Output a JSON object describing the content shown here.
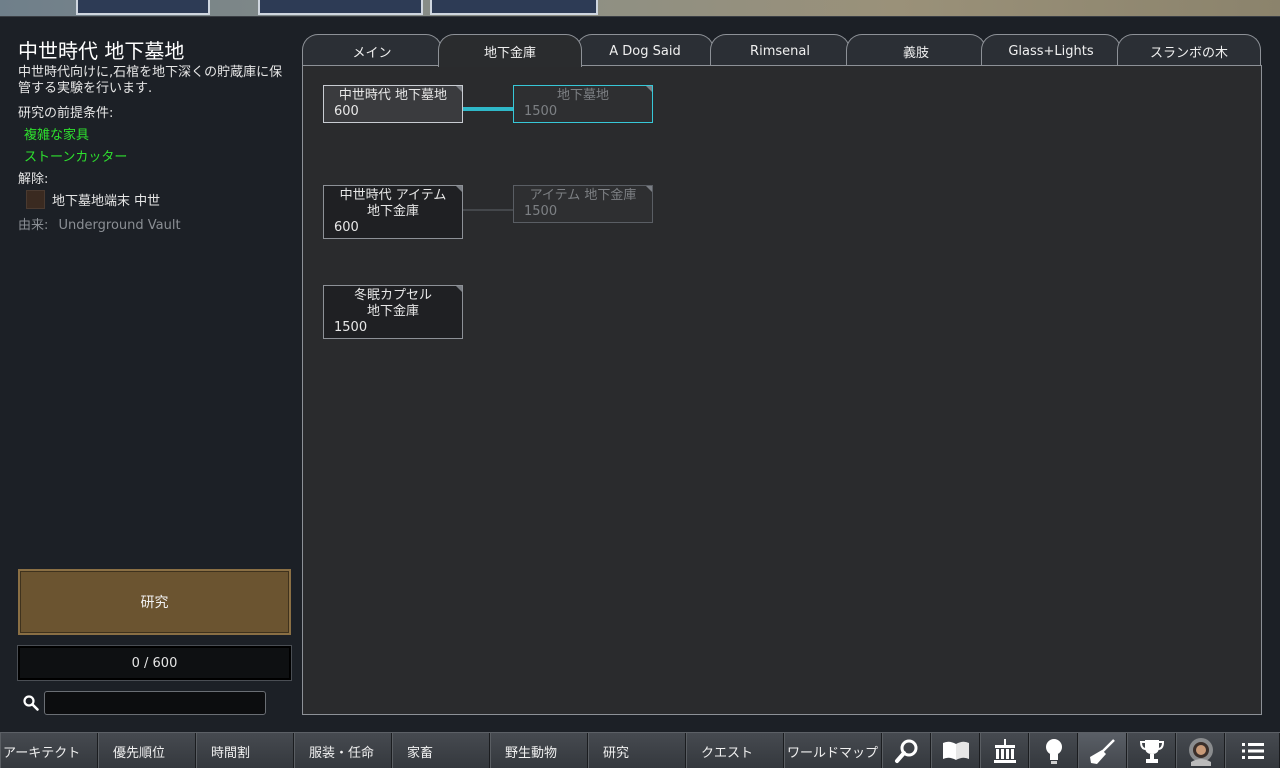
{
  "detail": {
    "title": "中世時代 地下墓地",
    "description": "中世時代向けに,石棺を地下深くの貯蔵庫に保管する実験を行います.",
    "prereq_heading": "研究の前提条件:",
    "prerequisites": [
      "複雑な家具",
      "ストーンカッター"
    ],
    "unlock_heading": "解除:",
    "unlocks": [
      "地下墓地端末 中世"
    ],
    "origin_label": "由来:",
    "origin_value": "Underground Vault"
  },
  "research_button": "研究",
  "progress": {
    "text": "0 / 600",
    "current": 0,
    "total": 600
  },
  "search": {
    "value": ""
  },
  "tabs": [
    "メイン",
    "地下金庫",
    "A Dog Said",
    "Rimsenal",
    "義肢",
    "Glass+Lights",
    "スランボの木"
  ],
  "active_tab": "地下金庫",
  "nodes": [
    {
      "title": "中世時代 地下墓地",
      "cost": "600",
      "state": "selected"
    },
    {
      "title": "地下墓地",
      "cost": "1500",
      "state": "locked"
    },
    {
      "title": "中世時代 アイテム 地下金庫",
      "cost": "600",
      "state": "available"
    },
    {
      "title": "アイテム 地下金庫",
      "cost": "1500",
      "state": "locked"
    },
    {
      "title": "冬眠カプセル 地下金庫",
      "cost": "1500",
      "state": "available"
    }
  ],
  "bottom_bar": {
    "buttons": [
      "アーキテクト",
      "優先順位",
      "時間割",
      "服装・任命",
      "家畜",
      "野生動物",
      "研究",
      "クエスト",
      "ワールドマップ"
    ],
    "icons": [
      "magnifier-icon",
      "book-icon",
      "factions-icon",
      "lightbulb-icon",
      "broom-icon",
      "trophy-icon",
      "astronaut-icon",
      "menu-list-icon"
    ]
  },
  "colors": {
    "prereq_met": "#2ee02e",
    "research_button": "#6b5430",
    "link_active": "#2fb8c8"
  }
}
